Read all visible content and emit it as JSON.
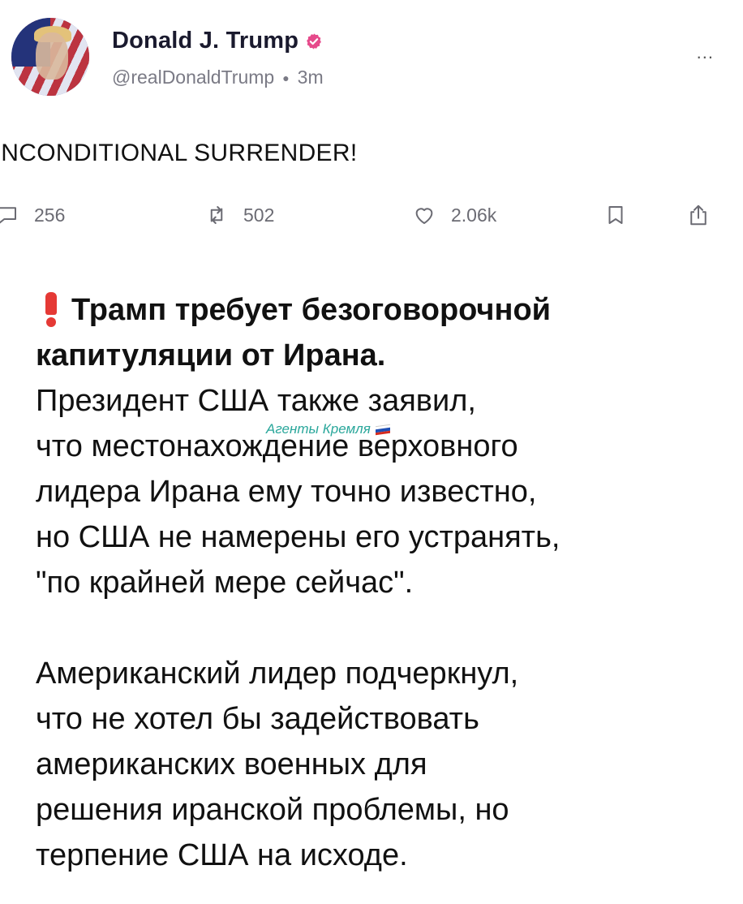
{
  "post": {
    "author_name": "Donald J. Trump",
    "handle": "@realDonaldTrump",
    "time_ago": "3m",
    "text": "JNCONDITIONAL SURRENDER!",
    "more_label": "...",
    "actions": {
      "replies": "256",
      "reposts": "502",
      "likes": "2.06k"
    },
    "verified_color": "#e64a8b"
  },
  "watermark": {
    "text": "Агенты Кремля"
  },
  "news": {
    "headline_line1": "Трамп требует безоговорочной",
    "headline_line2": "капитуляции от Ирана.",
    "lines": [
      "Президент США также заявил,",
      "что местонахождение верховного",
      "лидера Ирана ему точно известно,",
      "но США не намерены его устранять,",
      "\"по крайней мере сейчас\".",
      "",
      "Американский лидер подчеркнул,",
      "что не хотел бы задействовать",
      "американских военных для",
      "решения иранской проблемы, но",
      "терпение США на исходе."
    ]
  },
  "colors": {
    "accent_red": "#e53935",
    "watermark_teal": "#2aa79b",
    "muted_gray": "#6b6b73"
  }
}
